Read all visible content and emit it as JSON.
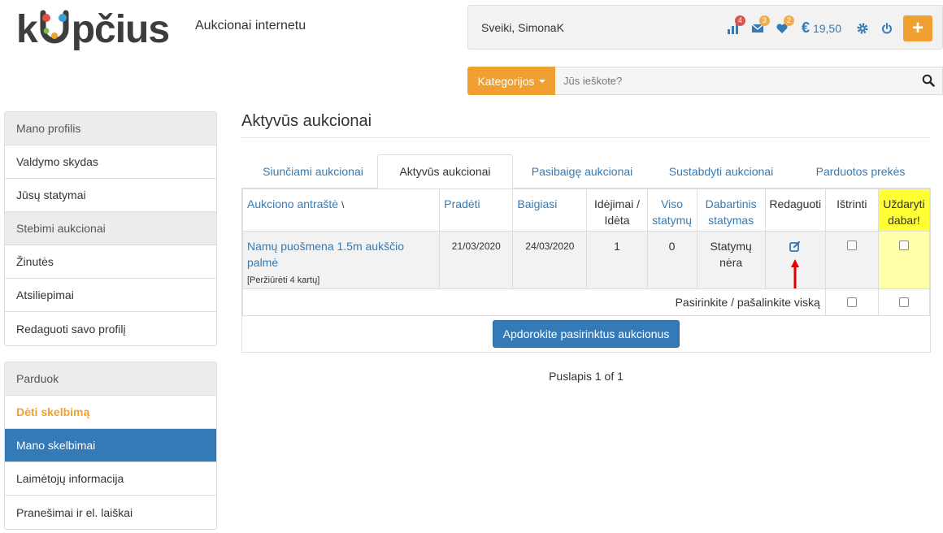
{
  "header": {
    "logo_parts": [
      "k",
      "pčius"
    ],
    "tagline": "Aukcionai internetu"
  },
  "user_bar": {
    "greeting": "Sveiki, SimonaK",
    "stats_badge": "4",
    "messages_badge": "3",
    "favorites_badge": "2",
    "currency_symbol": "€",
    "balance": "19,50",
    "plus_label": "+"
  },
  "search": {
    "categories_label": "Kategorijos",
    "placeholder": "Jūs ieškote?"
  },
  "sidebar": {
    "profile_panel": {
      "heading": "Mano profilis",
      "items": [
        "Valdymo skydas",
        "Jūsų statymai",
        "Stebimi aukcionai",
        "Žinutės",
        "Atsiliepimai",
        "Redaguoti savo profilį"
      ]
    },
    "sell_panel": {
      "heading": "Parduok",
      "items": [
        "Dėti skelbimą",
        "Mano skelbimai",
        "Laimėtojų informacija",
        "Pranešimai ir el. laiškai"
      ]
    }
  },
  "main": {
    "title": "Aktyvūs aukcionai",
    "tabs": [
      "Siunčiami aukcionai",
      "Aktyvūs aukcionai",
      "Pasibaigę aukcionai",
      "Sustabdyti aukcionai",
      "Parduotos prekės"
    ],
    "columns": {
      "title": "Aukciono antraštė",
      "sort_mark": "\\",
      "start": "Pradėti",
      "end": "Baigiasi",
      "listed_1": "Idėjimai /",
      "listed_2": "Idėta",
      "bids_1": "Viso",
      "bids_2": "statymų",
      "current_1": "Dabartinis",
      "current_2": "statymas",
      "edit": "Redaguoti",
      "delete": "Ištrinti",
      "close_1": "Uždaryti",
      "close_2": "dabar!"
    },
    "row": {
      "title_1": "Namų puošmena 1.5m aukščio",
      "title_2": "palmė",
      "views": "[Peržiūrėti 4 kartų]",
      "start": "21/03/2020",
      "end": "24/03/2020",
      "listed": "1",
      "bids": "0",
      "current_1": "Statymų",
      "current_2": "nėra"
    },
    "select_all": "Pasirinkite / pašalinkite viską",
    "process_button": "Apdorokite pasirinktus aukcionus",
    "pager": "Puslapis 1 of 1"
  },
  "colors": {
    "brand_orange": "#f0a030",
    "link_blue": "#337ab7",
    "highlight_yellow": "#ffff33",
    "arrow_red": "#e00000"
  }
}
